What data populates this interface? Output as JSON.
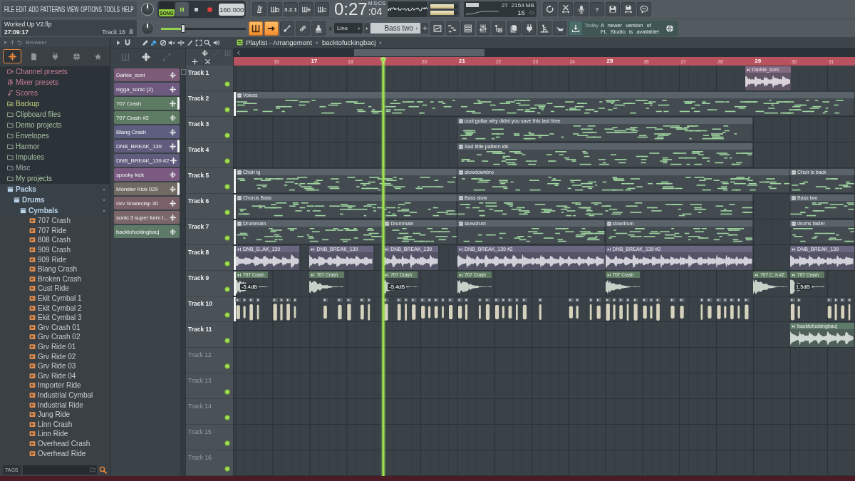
{
  "menu": [
    "FILE",
    "EDIT",
    "ADD",
    "PATTERNS",
    "VIEW",
    "OPTIONS",
    "TOOLS",
    "HELP"
  ],
  "project": {
    "file": "Worked Up V2.flp",
    "time": "27:09:17",
    "track": "Track 16"
  },
  "transport": {
    "mode": {
      "label": "SONG",
      "selected": true
    },
    "buttons": [
      {
        "kind": "pause",
        "on": true
      },
      {
        "kind": "stop",
        "on": false
      },
      {
        "kind": "record",
        "on": false
      }
    ],
    "tempo": "160.000",
    "slider": {
      "level": 0.26
    }
  },
  "record_tools": [
    {
      "kind": "metronome",
      "on": false
    },
    {
      "kind": "wait",
      "on": false
    },
    {
      "kind": "countdown",
      "label": "3.2.1",
      "on": false
    },
    {
      "kind": "step",
      "on": false
    },
    {
      "kind": "loop",
      "on": false
    }
  ],
  "time": {
    "value": "0:27",
    "fraction": ":04",
    "unit": "M:S:CS"
  },
  "meters": [
    {
      "level": 0.86
    },
    {
      "level": 0.86
    }
  ],
  "performance": {
    "cpu": "27",
    "memory": "2154 MB",
    "polyphony": "16"
  },
  "app_tools": [
    {
      "kind": "undo"
    },
    {
      "kind": "cut"
    },
    {
      "kind": "mic"
    },
    {
      "kind": "help",
      "label": "?"
    },
    {
      "kind": "save"
    },
    {
      "kind": "export"
    },
    {
      "kind": "chat"
    }
  ],
  "edit_toggles": [
    {
      "kind": "keys",
      "on": true
    },
    {
      "kind": "arrow",
      "on": true
    },
    {
      "kind": "slide",
      "on": false
    },
    {
      "kind": "link",
      "on": false
    },
    {
      "kind": "stamp",
      "on": false
    }
  ],
  "snap": {
    "value": "Line"
  },
  "pattern_selector": {
    "value": "Bass two"
  },
  "windows": [
    {
      "kind": "playlist"
    },
    {
      "kind": "steps"
    },
    {
      "kind": "rack"
    },
    {
      "kind": "mixer"
    },
    {
      "kind": "tree"
    },
    {
      "kind": "docs"
    },
    {
      "kind": "plug"
    },
    {
      "kind": "figure"
    },
    {
      "kind": "hand"
    }
  ],
  "news": {
    "day": "Today",
    "text": "A newer version of FL Studio is available!"
  },
  "browser": {
    "title": "Browser",
    "tabs": [
      {
        "kind": "all",
        "selected": true
      },
      {
        "kind": "files",
        "selected": false
      },
      {
        "kind": "plugins",
        "selected": false
      },
      {
        "kind": "online",
        "selected": false
      },
      {
        "kind": "starred",
        "selected": false
      }
    ],
    "tree": [
      {
        "label": "Channel presets",
        "kind": "preset",
        "expanded": false
      },
      {
        "label": "Mixer presets",
        "kind": "mixer",
        "expanded": false
      },
      {
        "label": "Scores",
        "kind": "score",
        "expanded": false
      },
      {
        "label": "Backup",
        "kind": "backup",
        "expanded": false
      },
      {
        "label": "Clipboard files",
        "kind": "folder",
        "expanded": false
      },
      {
        "label": "Demo projects",
        "kind": "folder",
        "expanded": false
      },
      {
        "label": "Envelopes",
        "kind": "folder",
        "expanded": false
      },
      {
        "label": "Harmor",
        "kind": "folder",
        "expanded": false
      },
      {
        "label": "Impulses",
        "kind": "folder",
        "expanded": false
      },
      {
        "label": "Misc",
        "kind": "dir",
        "expanded": false
      },
      {
        "label": "My projects",
        "kind": "folder",
        "expanded": false
      },
      {
        "label": "Packs",
        "kind": "pack",
        "expanded": true,
        "children": [
          {
            "label": "Drums",
            "kind": "pack",
            "expanded": true,
            "children": [
              {
                "label": "Cymbals",
                "kind": "pack",
                "expanded": true,
                "children": [
                  {
                    "label": "707 Crash",
                    "kind": "sample"
                  },
                  {
                    "label": "707 Ride",
                    "kind": "sample"
                  },
                  {
                    "label": "808 Crash",
                    "kind": "sample"
                  },
                  {
                    "label": "909 Crash",
                    "kind": "sample"
                  },
                  {
                    "label": "909 Ride",
                    "kind": "sample"
                  },
                  {
                    "label": "Blang Crash",
                    "kind": "sample"
                  },
                  {
                    "label": "Broken Crash",
                    "kind": "sample"
                  },
                  {
                    "label": "Cust Ride",
                    "kind": "sample"
                  },
                  {
                    "label": "Ekit Cymbal 1",
                    "kind": "sample"
                  },
                  {
                    "label": "Ekit Cymbal 2",
                    "kind": "sample"
                  },
                  {
                    "label": "Ekit Cymbal 3",
                    "kind": "sample"
                  },
                  {
                    "label": "Grv Crash 01",
                    "kind": "sample"
                  },
                  {
                    "label": "Grv Crash 02",
                    "kind": "sample"
                  },
                  {
                    "label": "Grv Ride 01",
                    "kind": "sample"
                  },
                  {
                    "label": "Grv Ride 02",
                    "kind": "sample"
                  },
                  {
                    "label": "Grv Ride 03",
                    "kind": "sample"
                  },
                  {
                    "label": "Grv Ride 04",
                    "kind": "sample"
                  },
                  {
                    "label": "Importer Ride",
                    "kind": "sample"
                  },
                  {
                    "label": "Industrial Cymbal",
                    "kind": "sample"
                  },
                  {
                    "label": "Industrial Ride",
                    "kind": "sample"
                  },
                  {
                    "label": "Jung Ride",
                    "kind": "sample"
                  },
                  {
                    "label": "Linn Crash",
                    "kind": "sample"
                  },
                  {
                    "label": "Linn Ride",
                    "kind": "sample"
                  },
                  {
                    "label": "Overhead Crash",
                    "kind": "sample"
                  },
                  {
                    "label": "Overhead Ride",
                    "kind": "sample"
                  }
                ]
              }
            ]
          }
        ]
      }
    ],
    "tags": {
      "label": "TAGS"
    }
  },
  "playlist": {
    "tools": [
      {
        "kind": "pencil",
        "selected": false
      },
      {
        "kind": "brush",
        "selected": true
      },
      {
        "kind": "delete",
        "selected": false
      },
      {
        "kind": "mute",
        "selected": false
      },
      {
        "kind": "slip",
        "selected": false
      },
      {
        "kind": "slice",
        "selected": false
      },
      {
        "kind": "select",
        "selected": false
      },
      {
        "kind": "zoom",
        "selected": false
      },
      {
        "kind": "playback",
        "selected": false
      }
    ],
    "title": "Playlist - Arrangement",
    "pattern": "backtofuckingbacj",
    "picker_filters": [
      {
        "kind": "pattern",
        "selected": false
      },
      {
        "kind": "audio",
        "selected": true
      },
      {
        "kind": "automation",
        "selected": false
      }
    ],
    "track_filters": [
      {
        "kind": "audio",
        "selected": true
      },
      {
        "kind": "automation",
        "selected": false
      },
      {
        "kind": "pattern",
        "selected": false
      }
    ],
    "picker": [
      {
        "label": "Darkie_soni",
        "color": "#7b5b78",
        "selected": false
      },
      {
        "label": "nigga_sonic (2)",
        "color": "#6f5a7f",
        "selected": false
      },
      {
        "label": "707 Crash",
        "color": "#5d7a62",
        "selected": true
      },
      {
        "label": "707 Crash #2",
        "color": "#5d7a62",
        "selected": false
      },
      {
        "label": "Blang Crash",
        "color": "#5e5f80",
        "selected": false
      },
      {
        "label": "DNB_BREAK_139",
        "color": "#615b7d",
        "selected": true
      },
      {
        "label": "DNB_BREAK_139 #2",
        "color": "#615b7d",
        "selected": false
      },
      {
        "label": "spooky kick",
        "color": "#7a5a80",
        "selected": false
      },
      {
        "label": "Monster Kick 029",
        "color": "#706a62",
        "selected": true
      },
      {
        "label": "Grv Snareclap 30",
        "color": "#7a6068",
        "selected": false
      },
      {
        "label": "sonic 3 super form t...",
        "color": "#7b676a",
        "selected": false
      },
      {
        "label": "backtofuckingbacj",
        "color": "#5d7a68",
        "selected": false
      }
    ],
    "ruler": [
      {
        "label": "16",
        "major": false
      },
      {
        "label": "17",
        "major": true
      },
      {
        "label": "18",
        "major": false
      },
      {
        "label": "20",
        "major": false
      },
      {
        "label": "21",
        "major": true
      },
      {
        "label": "22",
        "major": false
      },
      {
        "label": "23",
        "major": false
      },
      {
        "label": "24",
        "major": false
      },
      {
        "label": "25",
        "major": true
      },
      {
        "label": "26",
        "major": false
      },
      {
        "label": "27",
        "major": false
      },
      {
        "label": "28",
        "major": false
      },
      {
        "label": "29",
        "major": true
      },
      {
        "label": "30",
        "major": false
      },
      {
        "label": "31",
        "major": false
      }
    ],
    "tracks": [
      {
        "name": "Track 1",
        "empty": false,
        "muted": false,
        "clips": [
          {
            "name": "Darkie_soni",
            "kind": "audio",
            "color": "#846a82"
          }
        ]
      },
      {
        "name": "Track 2",
        "empty": false,
        "muted": false,
        "clips": [
          {
            "name": "Voices",
            "kind": "pattern",
            "color": "#5a6369"
          }
        ]
      },
      {
        "name": "Track 3",
        "empty": false,
        "muted": false,
        "clips": [
          {
            "name": "cool guitar why didnt you save this last time",
            "kind": "pattern",
            "color": "#5a6369"
          }
        ]
      },
      {
        "name": "Track 4",
        "empty": false,
        "muted": false,
        "clips": [
          {
            "name": "Sad little pattern idk",
            "kind": "pattern",
            "color": "#5a6369"
          }
        ]
      },
      {
        "name": "Track 5",
        "empty": false,
        "muted": false,
        "clips": [
          {
            "name": "Choir ig",
            "kind": "pattern",
            "color": "#5a6369"
          },
          {
            "name": "slowdownbro",
            "kind": "pattern",
            "color": "#5a6369"
          },
          {
            "name": "Choir is back",
            "kind": "pattern",
            "color": "#5a6369"
          }
        ]
      },
      {
        "name": "Track 6",
        "empty": false,
        "muted": false,
        "clips": [
          {
            "name": "Chorus Bass",
            "kind": "pattern",
            "color": "#5a6369"
          },
          {
            "name": "Bass slow",
            "kind": "pattern",
            "color": "#5a6369"
          },
          {
            "name": "Bass two",
            "kind": "pattern",
            "color": "#5a6369"
          }
        ]
      },
      {
        "name": "Track 7",
        "empty": false,
        "muted": false,
        "clips": [
          {
            "name": "Drummain",
            "kind": "pattern",
            "color": "#5a6369"
          },
          {
            "name": "Drummain",
            "kind": "pattern",
            "color": "#5a6369"
          },
          {
            "name": "slowdrum",
            "kind": "pattern",
            "color": "#5a6369"
          },
          {
            "name": "slowdrum",
            "kind": "pattern",
            "color": "#5a6369"
          },
          {
            "name": "drums faster",
            "kind": "pattern",
            "color": "#5a6369"
          }
        ]
      },
      {
        "name": "Track 8",
        "empty": false,
        "muted": false,
        "clips": [
          {
            "name": "DNB_B..AK_139",
            "kind": "audio",
            "color": "#6a6681"
          },
          {
            "name": "DNB_BREAK_139",
            "kind": "audio",
            "color": "#6a6681"
          },
          {
            "name": "DNB_BREAK_139",
            "kind": "audio",
            "color": "#6a6681"
          },
          {
            "name": "DNB_BREAK_139 #2",
            "kind": "audio",
            "color": "#6a6681"
          },
          {
            "name": "DNB_BREAK_139 #2",
            "kind": "audio",
            "color": "#6a6681"
          },
          {
            "name": "DNB_BREAK_139",
            "kind": "audio",
            "color": "#6a6681"
          }
        ]
      },
      {
        "name": "Track 9",
        "empty": false,
        "muted": false,
        "clips": [
          {
            "name": "707 Crash",
            "kind": "oneshot",
            "color": "#5e7b62",
            "gain": "-5.4dB"
          },
          {
            "name": "707 Crash",
            "kind": "oneshot",
            "color": "#5e7b62"
          },
          {
            "name": "707 Crash",
            "kind": "oneshot",
            "color": "#5e7b62",
            "gain": "-5.4dB"
          },
          {
            "name": "707 Crash",
            "kind": "oneshot",
            "color": "#5e7b62"
          },
          {
            "name": "707 Crash",
            "kind": "oneshot",
            "color": "#5e7b62"
          },
          {
            "name": "707 C..h #2",
            "kind": "oneshot",
            "color": "#5e7b62"
          },
          {
            "name": "707 Crash",
            "kind": "oneshot",
            "color": "#5e7b62",
            "gain": "1.5dB"
          }
        ]
      },
      {
        "name": "Track 10",
        "empty": false,
        "muted": false,
        "clips": [
          {
            "kind": "chops",
            "color": "#d6d2bd"
          }
        ]
      },
      {
        "name": "Track 11",
        "empty": false,
        "muted": false,
        "clips": [
          {
            "name": "backtofuckingbacj",
            "kind": "audio",
            "color": "#5f7b69"
          }
        ]
      },
      {
        "name": "Track 12",
        "empty": true,
        "muted": false
      },
      {
        "name": "Track 13",
        "empty": true,
        "muted": false
      },
      {
        "name": "Track 14",
        "empty": true,
        "muted": false
      },
      {
        "name": "Track 15",
        "empty": true,
        "muted": false
      },
      {
        "name": "Track 16",
        "empty": true,
        "muted": false
      }
    ]
  }
}
